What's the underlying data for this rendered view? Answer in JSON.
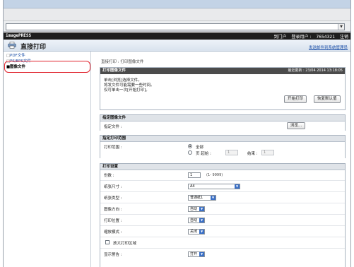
{
  "brand": {
    "name": "imagePRESS",
    "nav_top": "到门户",
    "user_label": "登录用户 :",
    "user_value": "7654321",
    "logout": "注销"
  },
  "header": {
    "title": "直接打印",
    "admin_link": "发送邮件到系统管理员"
  },
  "sidebar": {
    "items": [
      {
        "label": "PDF文件",
        "active": false
      },
      {
        "label": "PS/EPS文件",
        "active": false
      },
      {
        "label": "图像文件",
        "active": true
      }
    ]
  },
  "breadcrumb": "直接打印 : 打印图像文件",
  "print_panel": {
    "title": "打印图像文件",
    "updated": "最近更新 : 23/04 2014 13:18:05",
    "messages": [
      "单击[浏览]选择文件。",
      "将发文件可能需要一些时间。",
      "仅可单击一次[开始打印]。"
    ],
    "start_button": "开始打印",
    "reset_button": "恢复默认值"
  },
  "file_section": {
    "title": "指定图像文件",
    "label": "指定文件 :",
    "browse_button": "浏览..."
  },
  "range_section": {
    "title": "指定打印范围",
    "label": "打印范围 :",
    "all_label": "全部",
    "pages_label": "页  起始 :",
    "end_label": "结束 :",
    "start_value": "1",
    "end_value": "1"
  },
  "settings_section": {
    "title": "打印设置",
    "copies_label": "份数 :",
    "copies_value": "1",
    "copies_hint": "(1- 9999)",
    "paper_size_label": "纸张尺寸 :",
    "paper_size_value": "A4",
    "paper_type_label": "纸张类型 :",
    "paper_type_value": "普通纸1",
    "orientation_label": "图像方向 :",
    "orientation_value": "自动",
    "position_label": "打印位置 :",
    "position_value": "自动",
    "zoom_label": "缩放模式 :",
    "zoom_value": "关闭",
    "enlarge_label": "放大打印区域",
    "warning_label": "显示警告 :",
    "warning_value": "打开"
  },
  "icons": {
    "printer": "printer-icon",
    "dropdown": "chevron-down-icon"
  },
  "colors": {
    "brand_bar": "#1e1e1e",
    "panel_head": "#4b4b4b",
    "highlight": "#e0202a",
    "link": "#1b4fa8"
  }
}
